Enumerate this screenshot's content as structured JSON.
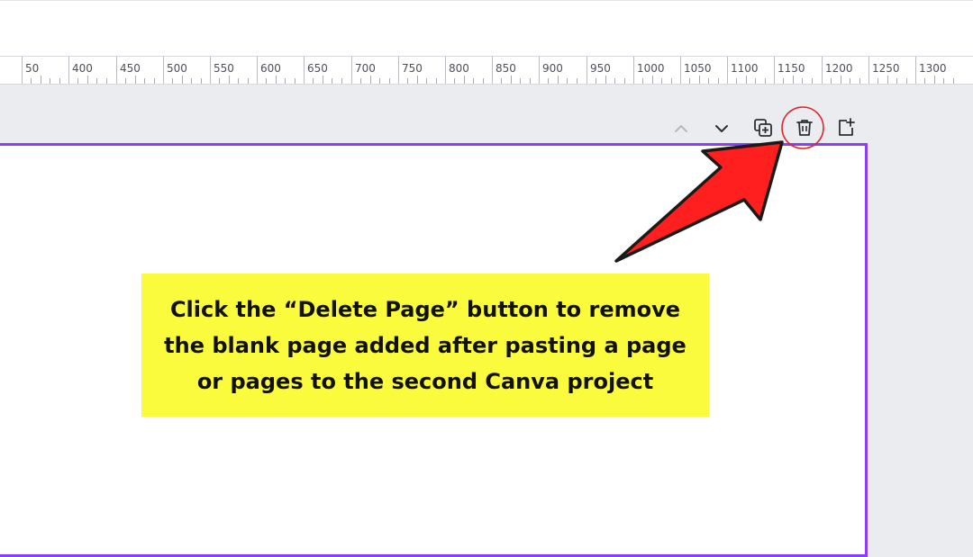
{
  "ruler": {
    "labels": [
      "50",
      "400",
      "450",
      "500",
      "550",
      "600",
      "650",
      "700",
      "750",
      "800",
      "850",
      "900",
      "950",
      "1000",
      "1050",
      "1100",
      "1150",
      "1200",
      "1250",
      "1300"
    ]
  },
  "page_toolbar": {
    "move_up_icon": "chevron-up-icon",
    "move_down_icon": "chevron-down-icon",
    "duplicate_icon": "duplicate-page-icon",
    "delete_icon": "trash-icon",
    "add_icon": "add-page-icon"
  },
  "callout": {
    "line1": "Click the “Delete Page” button to remove",
    "line2": "the blank page added after pasting a page",
    "line3": "or pages to the second Canva project"
  },
  "colors": {
    "page_border": "#8b3dff",
    "callout_bg": "#fbfb3d",
    "arrow_fill": "#ff1f1f",
    "highlight_circle": "#e0262e"
  }
}
